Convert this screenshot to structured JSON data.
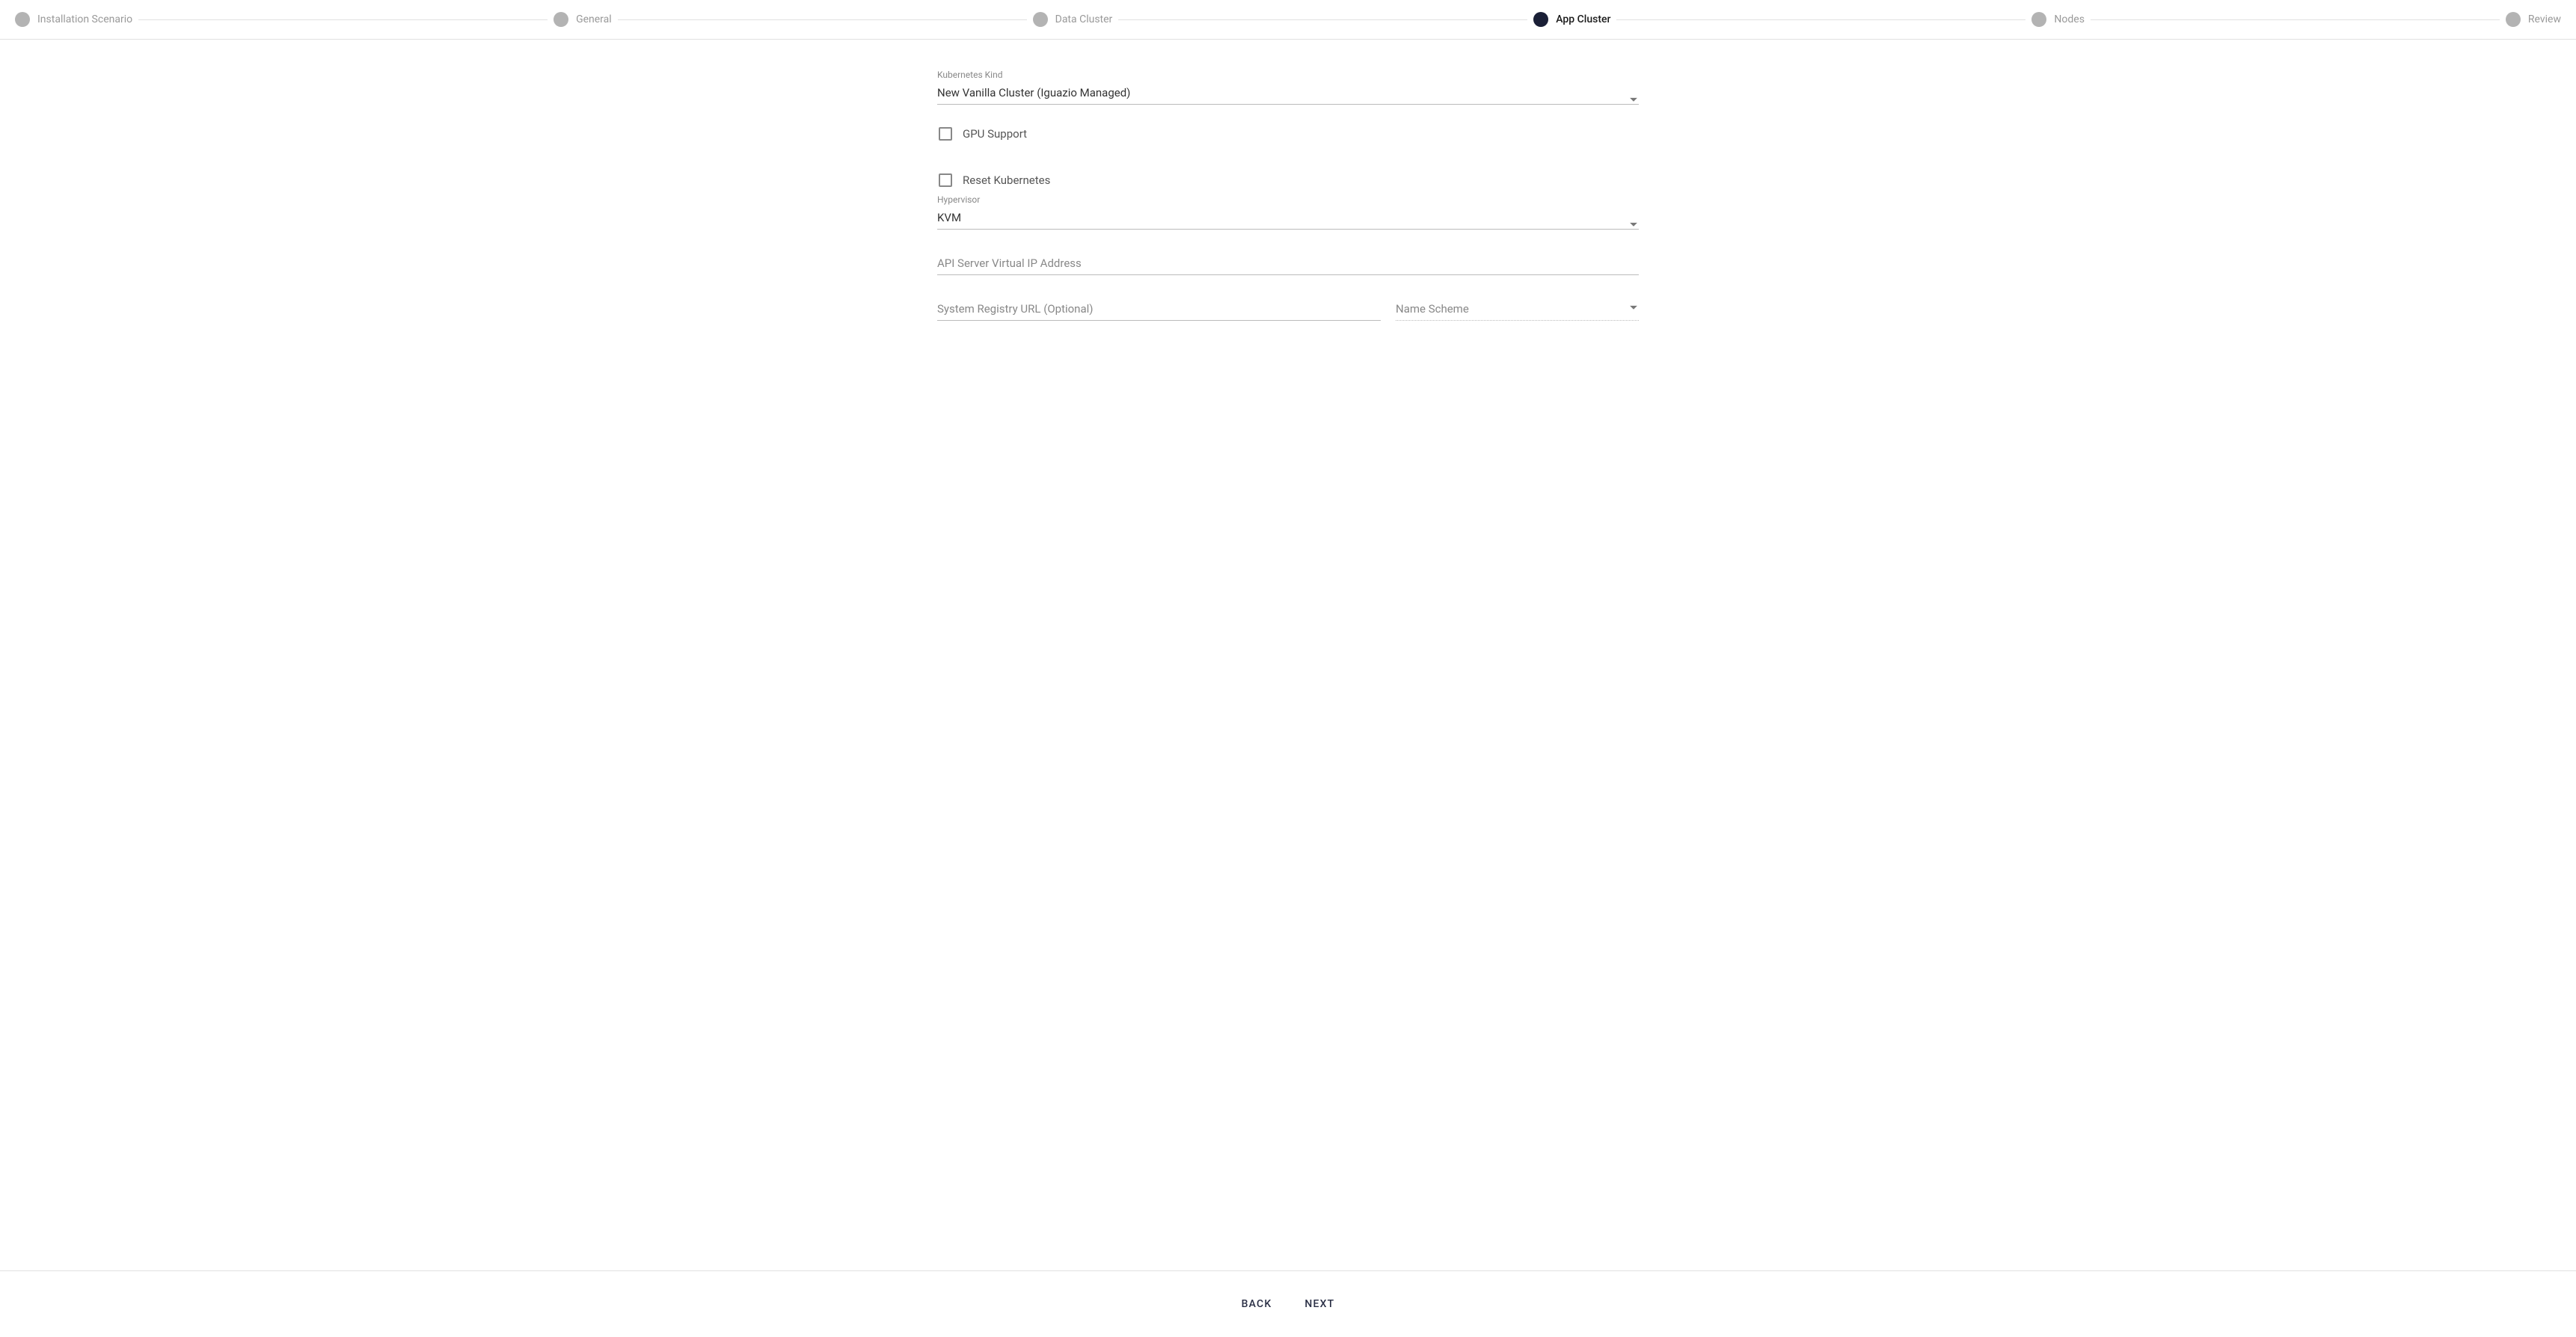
{
  "stepper": {
    "steps": [
      {
        "label": "Installation Scenario"
      },
      {
        "label": "General"
      },
      {
        "label": "Data Cluster"
      },
      {
        "label": "App Cluster"
      },
      {
        "label": "Nodes"
      },
      {
        "label": "Review"
      }
    ],
    "activeIndex": 3
  },
  "form": {
    "kubernetes_kind": {
      "label": "Kubernetes Kind",
      "value": "New Vanilla Cluster (Iguazio Managed)"
    },
    "gpu_support": {
      "label": "GPU Support",
      "checked": false
    },
    "reset_kubernetes": {
      "label": "Reset Kubernetes",
      "checked": false
    },
    "hypervisor": {
      "label": "Hypervisor",
      "value": "KVM"
    },
    "api_server_vip": {
      "placeholder": "API Server Virtual IP Address",
      "value": ""
    },
    "system_registry_url": {
      "placeholder": "System Registry URL (Optional)",
      "value": ""
    },
    "name_scheme": {
      "placeholder": "Name Scheme",
      "value": ""
    }
  },
  "buttons": {
    "back": "BACK",
    "next": "NEXT"
  }
}
